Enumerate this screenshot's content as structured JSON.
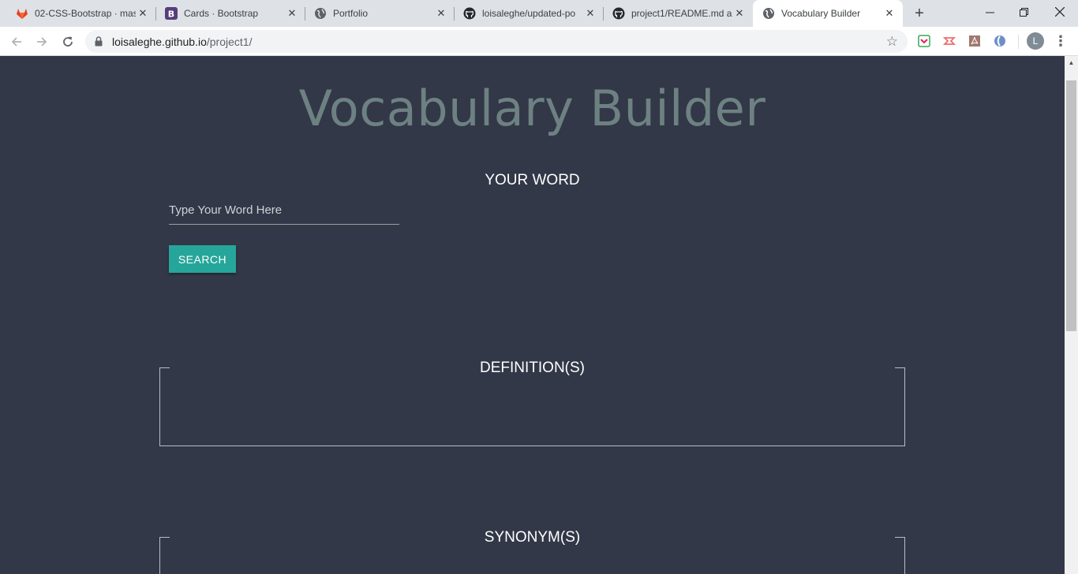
{
  "browser": {
    "tabs": [
      {
        "title": "02-CSS-Bootstrap · mas",
        "icon": "gitlab-icon"
      },
      {
        "title": "Cards · Bootstrap",
        "icon": "bootstrap-icon"
      },
      {
        "title": "Portfolio",
        "icon": "globe-icon"
      },
      {
        "title": "loisaleghe/updated-po",
        "icon": "github-icon"
      },
      {
        "title": "project1/README.md a",
        "icon": "github-icon"
      },
      {
        "title": "Vocabulary Builder",
        "icon": "globe-icon",
        "active": true
      }
    ],
    "url_host": "loisaleghe.github.io",
    "url_path": "/project1/",
    "profile_initial": "L"
  },
  "page": {
    "title": "Vocabulary Builder",
    "word_heading": "YOUR WORD",
    "input_placeholder": "Type Your Word Here",
    "input_value": "",
    "search_label": "SEARCH",
    "definitions_heading": "DEFINITION(S)",
    "synonyms_heading": "SYNONYM(S)"
  },
  "colors": {
    "background": "#323848",
    "title": "#6e8182",
    "accent": "#26a69a"
  }
}
